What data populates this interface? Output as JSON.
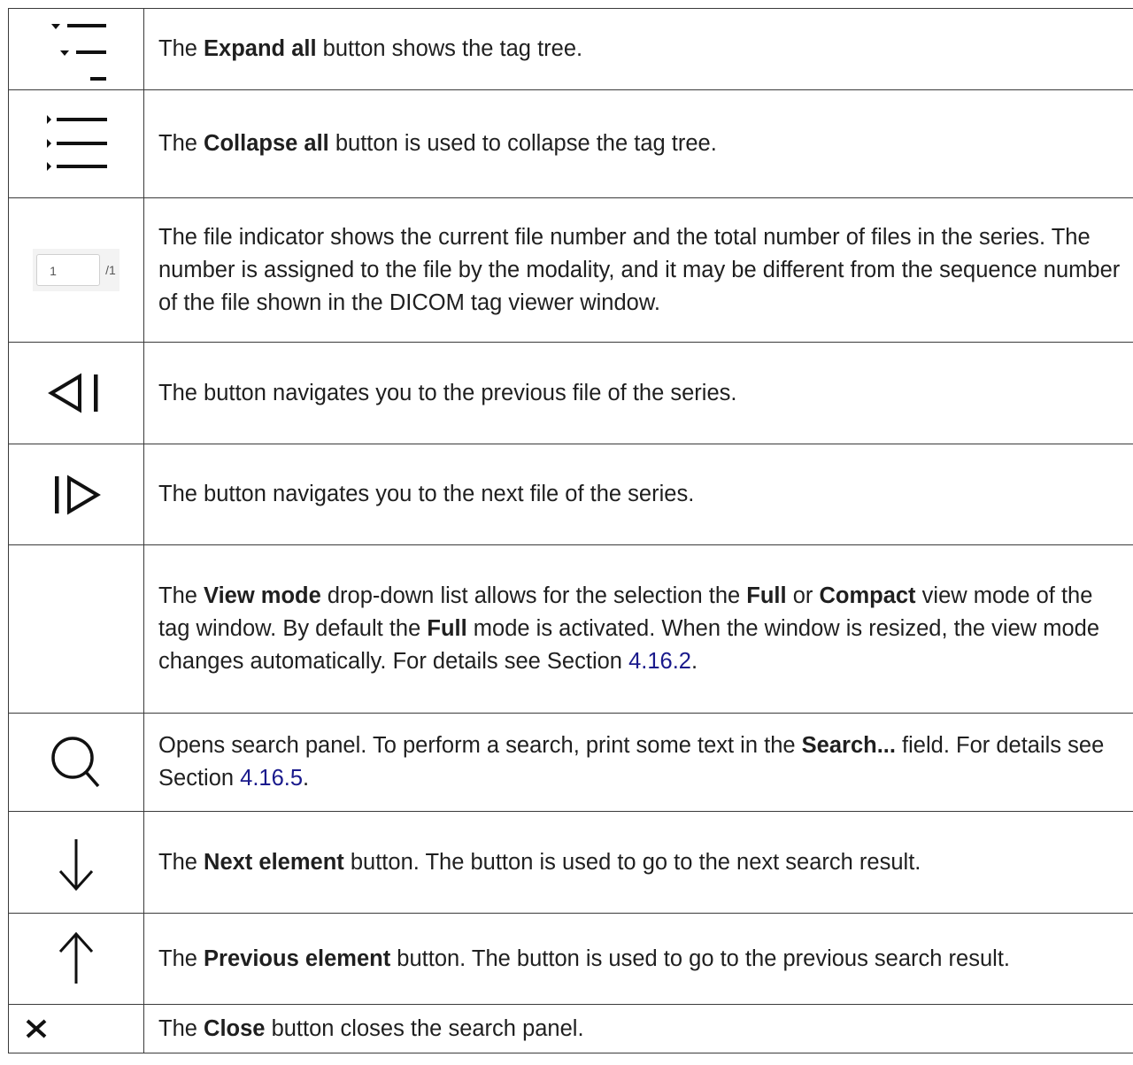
{
  "rows": [
    {
      "icon": "expand-all-icon",
      "pre": "The ",
      "b1": "Expand all",
      "post": " button shows the tag tree."
    },
    {
      "icon": "collapse-all-icon",
      "pre": "The ",
      "b1": "Collapse all",
      "post": " button is used to collapse the tag tree."
    },
    {
      "icon": "file-indicator",
      "current": "1",
      "total": "/1",
      "text": "The file indicator shows the current file number and the total number of files in the series. The number is assigned to the file by the modality, and it may be different from the sequence number of the file shown in the DICOM tag viewer window."
    },
    {
      "icon": "previous-file-icon",
      "text": "The button navigates you to the previous file of the series."
    },
    {
      "icon": "next-file-icon",
      "text": "The button navigates you to the next file of the series."
    },
    {
      "pre": "The ",
      "b1": "View mode",
      "mid1": " drop-down list allows for the selection the ",
      "b2": "Full",
      "mid2": " or ",
      "b3": "Compact",
      "mid3": " view mode of the tag window. By default the ",
      "b4": "Full",
      "mid4": " mode is activated. When the window is resized, the view mode changes automatically. For details see Section ",
      "link": "4.16.2",
      "post": "."
    },
    {
      "icon": "search-icon",
      "pre": "Opens search panel. To perform a search, print some text in the ",
      "b1": "Search...",
      "mid1": " field. For details see Section ",
      "link": "4.16.5",
      "post": "."
    },
    {
      "icon": "arrow-down-icon",
      "pre": "The ",
      "b1": "Next element",
      "post": " button. The button is used to go to the next search result."
    },
    {
      "icon": "arrow-up-icon",
      "pre": "The ",
      "b1": "Previous element",
      "post": " button. The button is used to go to the previous search result."
    },
    {
      "icon": "close-icon",
      "pre": "The ",
      "b1": "Close",
      "post": " button closes the search panel."
    }
  ]
}
